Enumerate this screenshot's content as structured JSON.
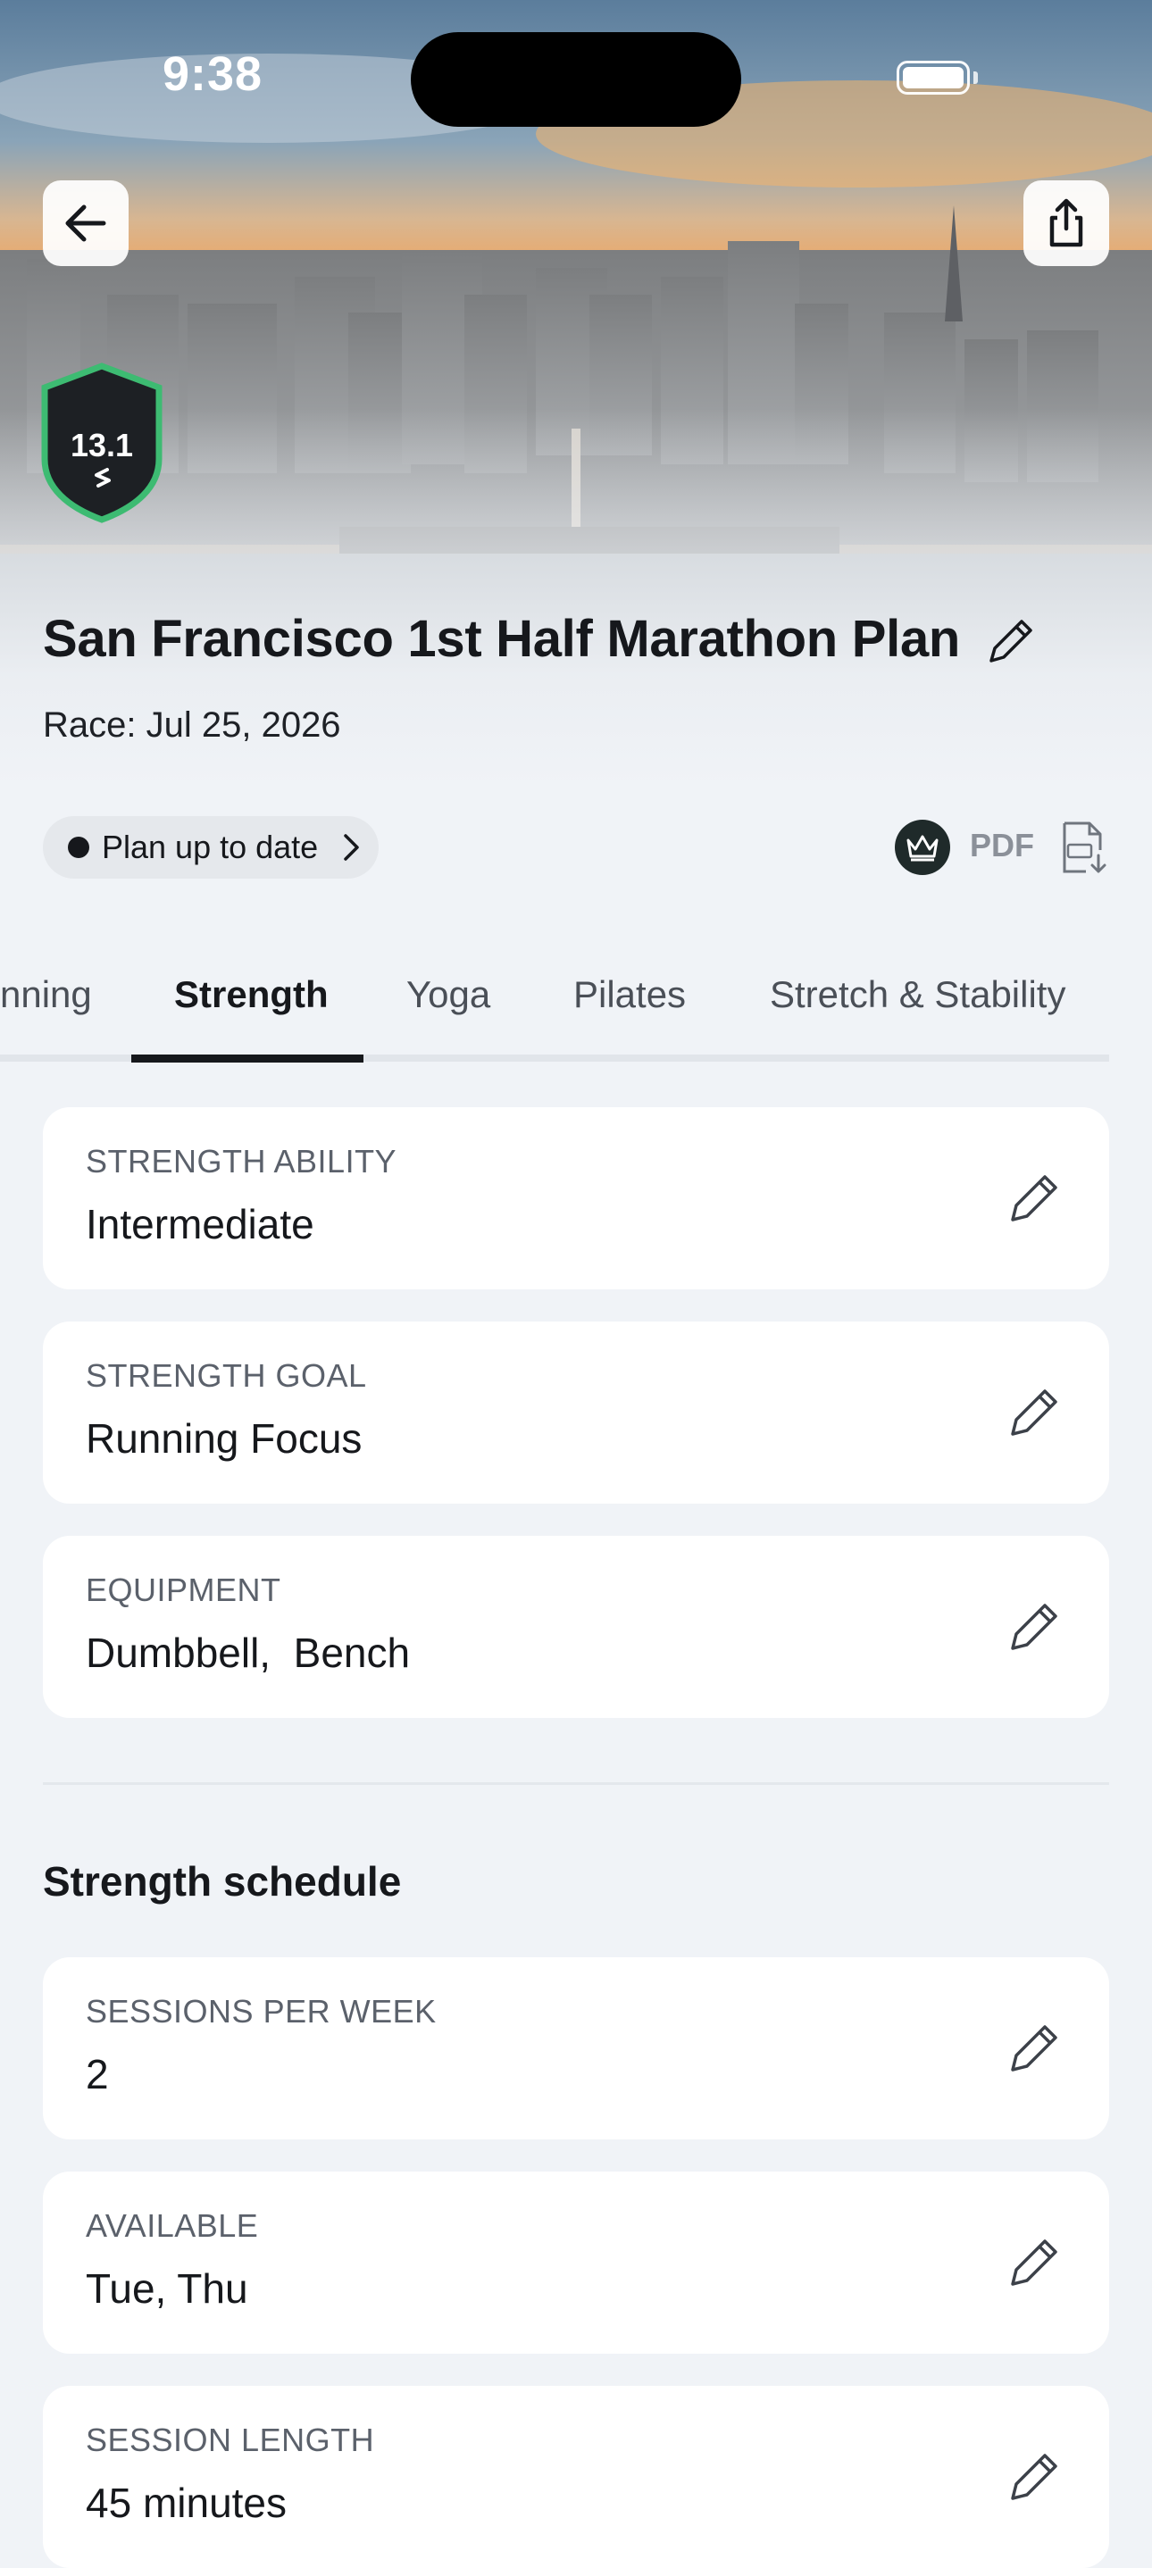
{
  "status_bar": {
    "time": "9:38"
  },
  "header": {
    "badge_distance": "13.1",
    "title": "San Francisco 1st Half Marathon Plan",
    "race_date": "Race: Jul 25, 2026"
  },
  "plan_status": {
    "label": "Plan up to date"
  },
  "export": {
    "pdf_label": "PDF"
  },
  "tabs": [
    {
      "label": "nning",
      "active": false
    },
    {
      "label": "Strength",
      "active": true
    },
    {
      "label": "Yoga",
      "active": false
    },
    {
      "label": "Pilates",
      "active": false
    },
    {
      "label": "Stretch & Stability",
      "active": false
    }
  ],
  "strength_settings": [
    {
      "label": "STRENGTH ABILITY",
      "value": "Intermediate"
    },
    {
      "label": "STRENGTH GOAL",
      "value": "Running Focus"
    },
    {
      "label": "EQUIPMENT",
      "value": "Dumbbell,  Bench"
    }
  ],
  "schedule": {
    "title": "Strength schedule",
    "items": [
      {
        "label": "SESSIONS PER WEEK",
        "value": "2"
      },
      {
        "label": "AVAILABLE",
        "value": "Tue, Thu"
      },
      {
        "label": "SESSION LENGTH",
        "value": "45 minutes"
      }
    ]
  },
  "icons": {
    "back": "arrow-left-icon",
    "share": "share-icon",
    "edit": "pencil-icon",
    "premium": "crown-icon",
    "pdf_download": "pdf-download-icon"
  },
  "colors": {
    "badge_fill": "#1d2024",
    "badge_ring": "#3dbb72",
    "background": "#f0f3f7",
    "card": "#ffffff",
    "text_primary": "#16181c",
    "text_secondary": "#5b616b"
  }
}
